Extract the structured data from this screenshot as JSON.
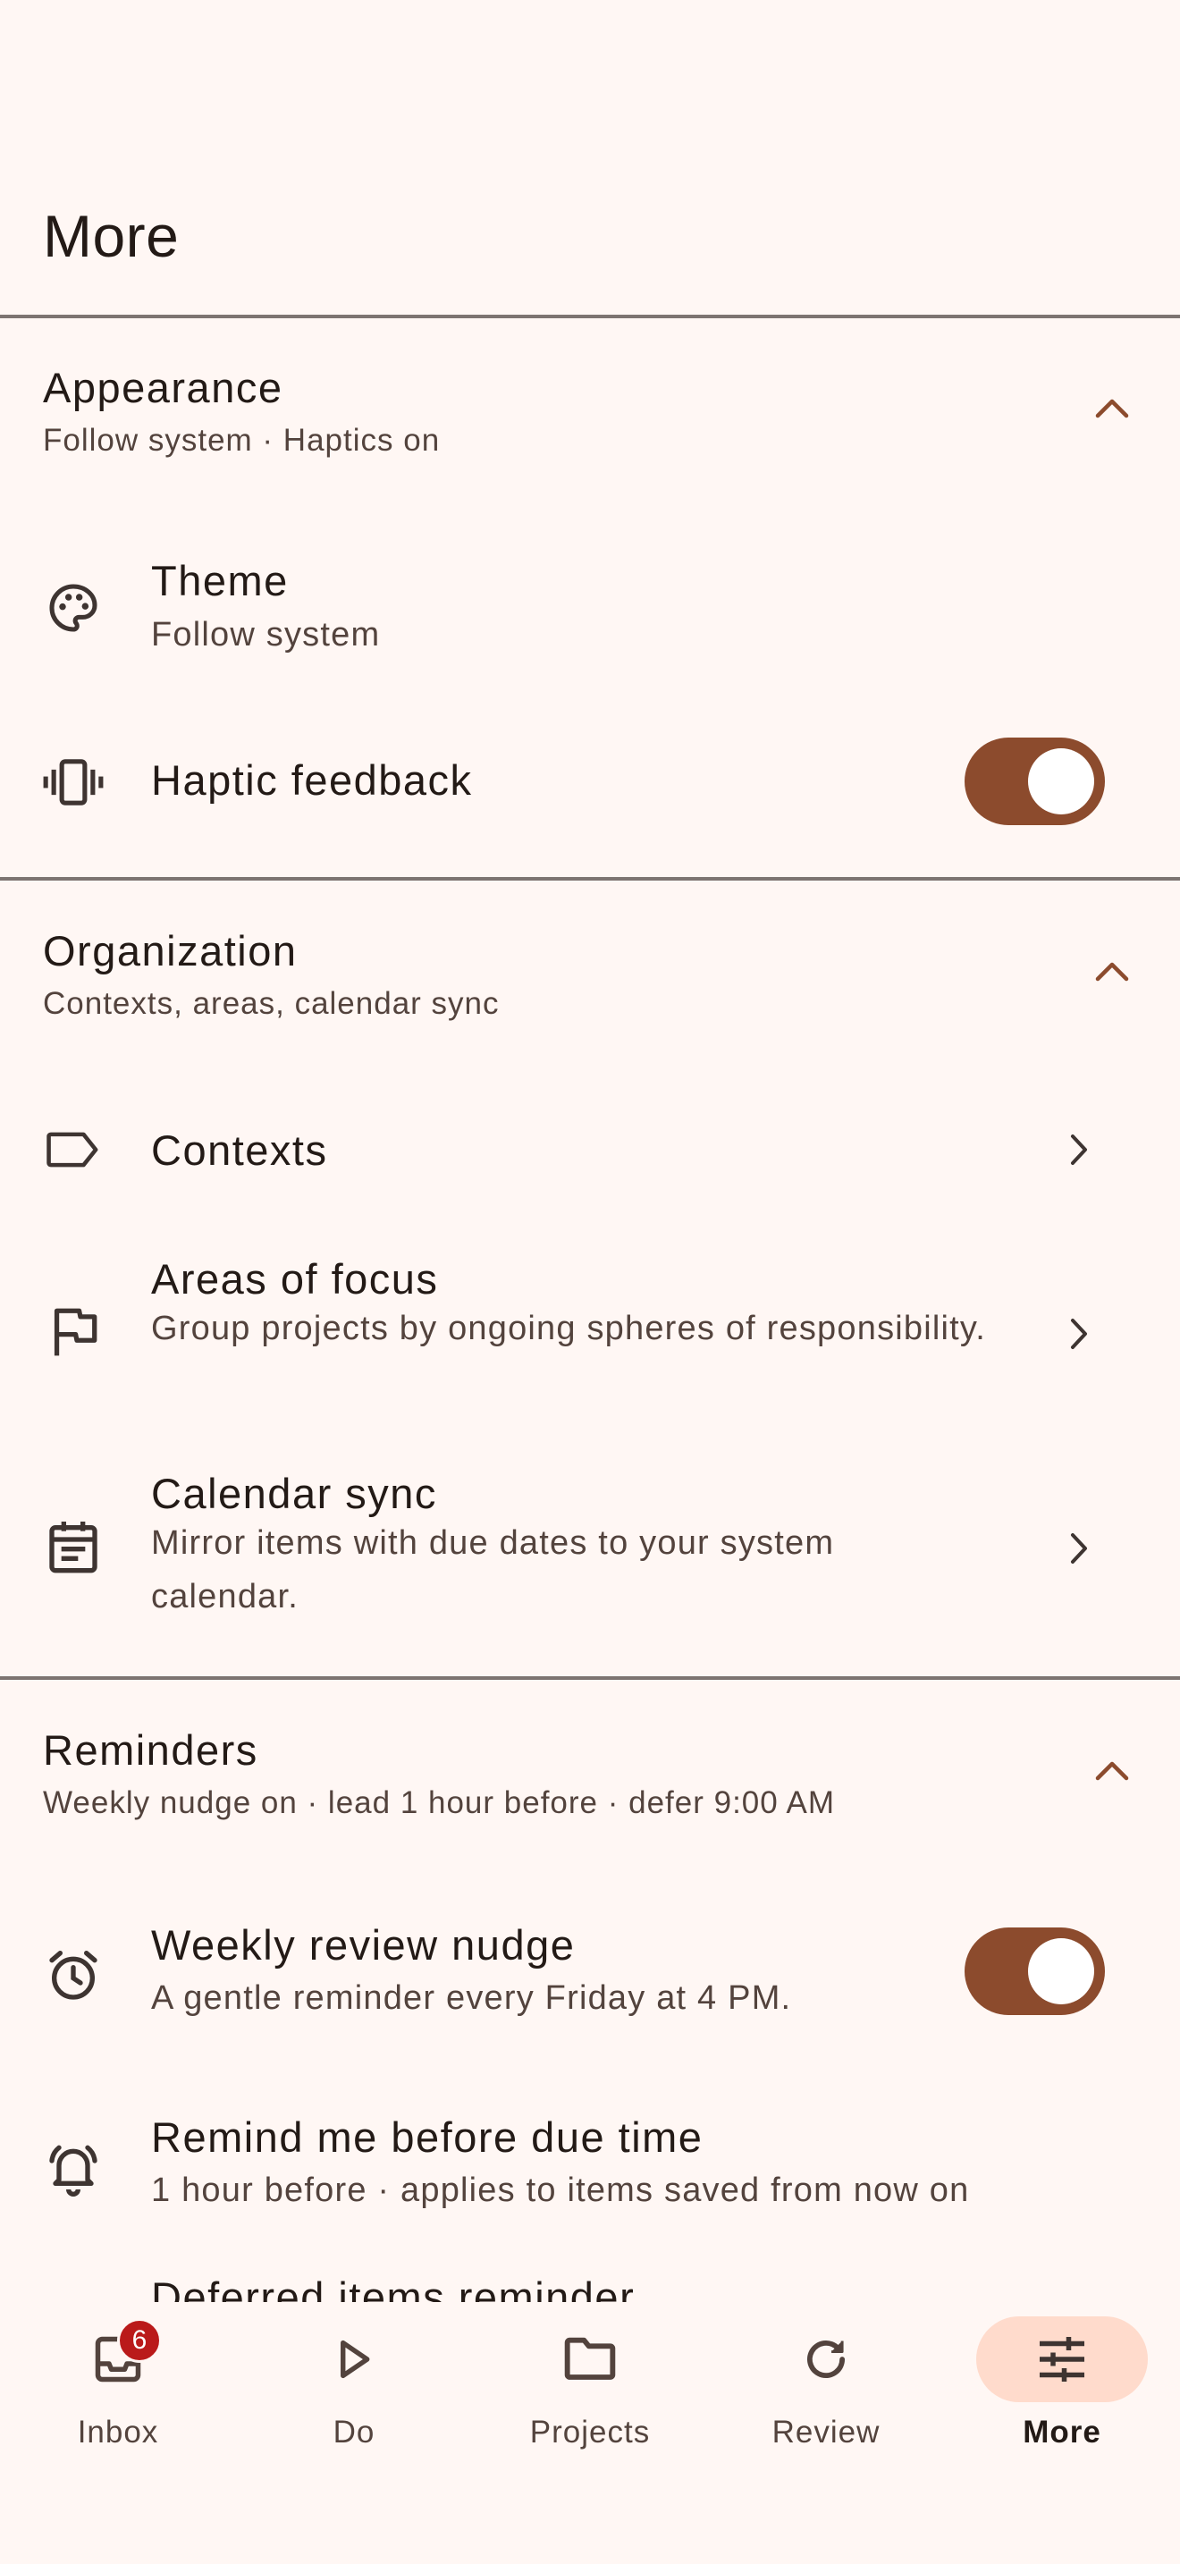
{
  "header": {
    "title": "More"
  },
  "sections": {
    "appearance": {
      "title": "Appearance",
      "summary": "Follow system · Haptics on",
      "rows": {
        "theme": {
          "title": "Theme",
          "subtitle": "Follow system",
          "icon": "palette-icon"
        },
        "haptic": {
          "title": "Haptic feedback",
          "icon": "vibration-icon",
          "enabled": true
        }
      }
    },
    "organization": {
      "title": "Organization",
      "summary": "Contexts, areas, calendar sync",
      "rows": {
        "contexts": {
          "title": "Contexts",
          "icon": "label-icon"
        },
        "areas": {
          "title": "Areas of focus",
          "subtitle": "Group projects by ongoing spheres of responsibility.",
          "icon": "flag-icon"
        },
        "calendar": {
          "title": "Calendar sync",
          "subtitle": "Mirror items with due dates to your system calendar.",
          "icon": "calendar-icon"
        }
      }
    },
    "reminders": {
      "title": "Reminders",
      "summary": "Weekly nudge on · lead 1 hour before · defer 9:00 AM",
      "rows": {
        "weekly": {
          "title": "Weekly review nudge",
          "subtitle": "A gentle reminder every Friday at 4 PM.",
          "icon": "alarm-icon",
          "enabled": true
        },
        "remind": {
          "title": "Remind me before due time",
          "subtitle": "1 hour before · applies to items saved from now on",
          "icon": "bell-ring-icon"
        },
        "deferred": {
          "title": "Deferred items reminder"
        }
      }
    }
  },
  "nav": {
    "items": [
      {
        "label": "Inbox",
        "icon": "inbox-icon",
        "badge": "6"
      },
      {
        "label": "Do",
        "icon": "play-icon"
      },
      {
        "label": "Projects",
        "icon": "folder-icon"
      },
      {
        "label": "Review",
        "icon": "refresh-icon"
      },
      {
        "label": "More",
        "icon": "tune-icon",
        "active": true
      }
    ]
  },
  "colors": {
    "background": "#fff7f4",
    "accent": "#8c4b2d",
    "active_pill": "#ffdbcc",
    "badge": "#ba1a1a"
  }
}
